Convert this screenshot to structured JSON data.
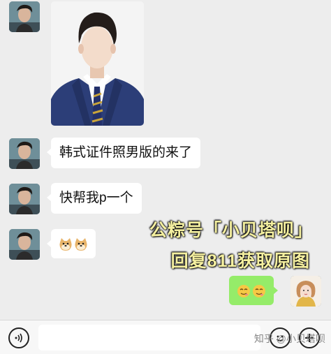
{
  "messages": [
    {
      "text": "韩式证件照男版的来了"
    },
    {
      "text": "快帮我p一个"
    }
  ],
  "overlay": {
    "line1": "公粽号「小贝塔呗」",
    "line2": "回复811获取原图"
  },
  "watermark": "知乎 @小贝塔呗",
  "icons": {
    "voice": "voice-icon",
    "emoji": "emoji-icon",
    "add": "plus-icon"
  },
  "colors": {
    "background": "#ededed",
    "my_bubble": "#95ec69",
    "other_bubble": "#ffffff",
    "overlay_text": "#f5f0a0"
  }
}
